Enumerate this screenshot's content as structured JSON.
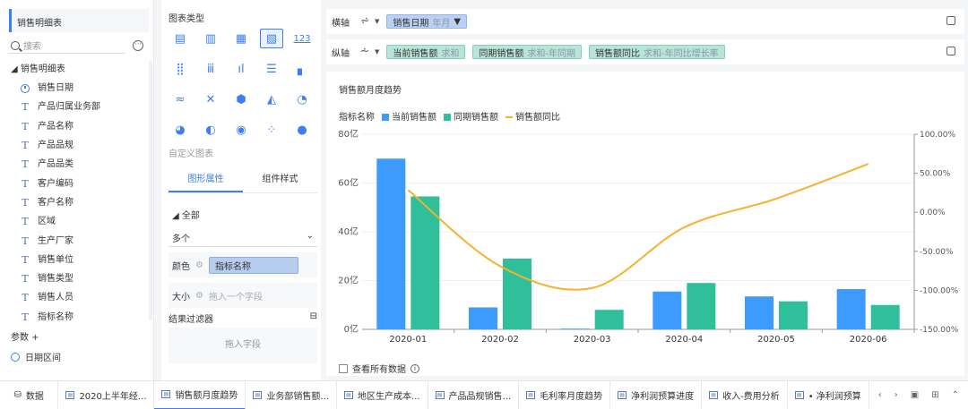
{
  "left": {
    "table_title": "销售明细表",
    "search_placeholder": "搜索",
    "tree_head": "◢ 销售明细表",
    "fields": [
      {
        "icon": "clock-icon",
        "label": "销售日期"
      },
      {
        "icon": "text-field-icon",
        "label": "产品归属业务部"
      },
      {
        "icon": "text-field-icon",
        "label": "产品名称"
      },
      {
        "icon": "text-field-icon",
        "label": "产品品规"
      },
      {
        "icon": "text-field-icon",
        "label": "产品品类"
      },
      {
        "icon": "text-field-icon",
        "label": "客户编码"
      },
      {
        "icon": "text-field-icon",
        "label": "客户名称"
      },
      {
        "icon": "text-field-icon",
        "label": "区域"
      },
      {
        "icon": "text-field-icon",
        "label": "生产厂家"
      },
      {
        "icon": "text-field-icon",
        "label": "销售单位"
      },
      {
        "icon": "text-field-icon",
        "label": "销售类型"
      },
      {
        "icon": "text-field-icon",
        "label": "销售人员"
      },
      {
        "icon": "text-field-icon",
        "label": "指标名称"
      }
    ],
    "params_label": "参数 +",
    "date_range_label": "日期区间"
  },
  "mid": {
    "title": "图表类型",
    "custom_chart": "自定义图表",
    "tab_props": "图形属性",
    "tab_style": "组件样式",
    "all_label": "◢ 全部",
    "select_value": "多个",
    "color_label": "颜色",
    "color_chip": "指标名称",
    "size_label": "大小",
    "size_placeholder": "拖入一个字段",
    "filter_title": "结果过滤器",
    "drop_field": "拖入字段"
  },
  "axes": {
    "x_label": "横轴",
    "x_chip": {
      "name": "销售日期",
      "sub": "年月",
      "icon": "filter-icon"
    },
    "y_label": "纵轴",
    "y_chips": [
      {
        "name": "当前销售额",
        "sub": "求和"
      },
      {
        "name": "同期销售额",
        "sub": "求和-年同期"
      },
      {
        "name": "销售额同比",
        "sub": "求和-年同比增长率"
      }
    ]
  },
  "chart_meta": {
    "title": "销售额月度趋势",
    "legend_title": "指标名称",
    "show_all": "查看所有数据"
  },
  "chart_data": {
    "type": "bar",
    "categories": [
      "2020-01",
      "2020-02",
      "2020-03",
      "2020-04",
      "2020-05",
      "2020-06"
    ],
    "series": [
      {
        "name": "当前销售额",
        "type": "bar",
        "axis": "left",
        "color": "#3d9bff",
        "values": [
          70,
          9,
          0.3,
          15.5,
          13.5,
          16.5
        ]
      },
      {
        "name": "同期销售额",
        "type": "bar",
        "axis": "left",
        "color": "#2fbf9b",
        "values": [
          54.5,
          29,
          8,
          19,
          11.5,
          10
        ]
      },
      {
        "name": "销售额同比",
        "type": "line",
        "axis": "right",
        "color": "#f5b22c",
        "values": [
          28.6,
          -69,
          -97,
          -19.4,
          17.4,
          62
        ]
      }
    ],
    "y_left": {
      "min": 0,
      "max": 80,
      "ticks": [
        "0亿",
        "20亿",
        "40亿",
        "60亿",
        "80亿"
      ]
    },
    "y_right": {
      "min": -150,
      "max": 100,
      "ticks": [
        "-150.00%",
        "-100.00%",
        "-50.00%",
        "0.00%",
        "50.00%",
        "100.00%"
      ]
    },
    "grid": true,
    "legend_position": "top-left"
  },
  "bottom_tabs": [
    {
      "label": "数据",
      "kind": "data"
    },
    {
      "label": "2020上半年经..."
    },
    {
      "label": "销售额月度趋势",
      "active": true
    },
    {
      "label": "业务部销售额..."
    },
    {
      "label": "地区生产成本..."
    },
    {
      "label": "产品品规销售..."
    },
    {
      "label": "毛利率月度趋势"
    },
    {
      "label": "净利润预算进度"
    },
    {
      "label": "收入-费用分析"
    },
    {
      "label": "• 净利润预算"
    }
  ],
  "colors": {
    "accent": "#3d7ef7",
    "bar_current": "#3d9bff",
    "bar_prior": "#2fbf9b",
    "line_yoy": "#f5b22c"
  }
}
